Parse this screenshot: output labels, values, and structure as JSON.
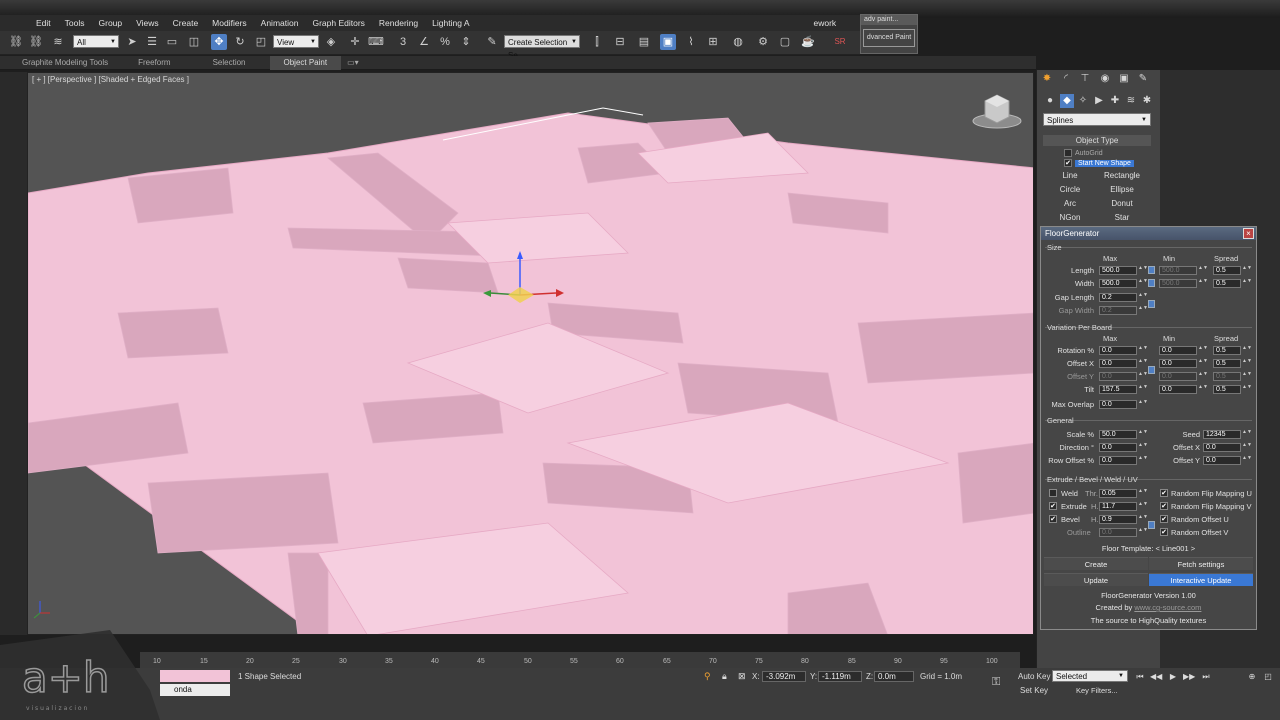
{
  "menu": [
    "Edit",
    "Tools",
    "Group",
    "Views",
    "Create",
    "Modifiers",
    "Animation",
    "Graph Editors",
    "Rendering",
    "Lighting A"
  ],
  "menu_extra": "ework",
  "toolbar": {
    "selection_set": "All",
    "view_dropdown": "View",
    "named_selection": "Create Selection Se"
  },
  "ribbon_tabs": [
    "Graphite Modeling Tools",
    "Freeform",
    "Selection",
    "Object Paint"
  ],
  "ribbon_active": "Object Paint",
  "advpaint": {
    "title": "adv paint...",
    "button": "dvanced Paint"
  },
  "viewport": {
    "label": "[ + ] [Perspective ] [Shaded + Edged Faces ]"
  },
  "command_panel": {
    "category": "Splines",
    "rollout": "Object Type",
    "autogrid": "AutoGrid",
    "start_new_shape": "Start New Shape",
    "shapes": [
      "Line",
      "Rectangle",
      "Circle",
      "Ellipse",
      "Arc",
      "Donut",
      "NGon",
      "Star"
    ]
  },
  "floorgen": {
    "title": "FloorGenerator",
    "size_group": "Size",
    "col_max": "Max",
    "col_min": "Min",
    "col_spread": "Spread",
    "length_label": "Length",
    "length_max": "500.0",
    "length_min": "500.0",
    "length_spread": "0.5",
    "width_label": "Width",
    "width_max": "500.0",
    "width_min": "500.0",
    "width_spread": "0.5",
    "gap_length_label": "Gap Length",
    "gap_length": "0.2",
    "gap_width_label": "Gap Width",
    "gap_width": "0.2",
    "variation_group": "Variation Per Board",
    "rotation_label": "Rotation %",
    "rotation_max": "0.0",
    "rotation_min": "0.0",
    "rotation_spread": "0.5",
    "offsetx_label": "Offset X",
    "offsetx_max": "0.0",
    "offsetx_min": "0.0",
    "offsetx_spread": "0.5",
    "offsety_label": "Offset Y",
    "offsety_max": "0.0",
    "offsety_min": "0.0",
    "offsety_spread": "0.5",
    "tilt_label": "Tilt",
    "tilt_max": "157.5",
    "tilt_min": "0.0",
    "tilt_spread": "0.5",
    "max_overlap_label": "Max Overlap",
    "max_overlap": "0.0",
    "general_group": "General",
    "scale_label": "Scale %",
    "scale": "50.0",
    "seed_label": "Seed",
    "seed": "12345",
    "direction_label": "Direction °",
    "direction": "0.0",
    "goffsetx_label": "Offset X",
    "goffsetx": "0.0",
    "row_offset_label": "Row Offset %",
    "row_offset": "0.0",
    "goffsety_label": "Offset Y",
    "goffsety": "0.0",
    "extrude_group": "Extrude / Bevel / Weld / UV",
    "weld_label": "Weld",
    "weld_thr_label": "Thr.",
    "weld_thr": "0.05",
    "extrude_label": "Extrude",
    "extrude_h_label": "H.",
    "extrude_h": "11.7",
    "bevel_label": "Bevel",
    "bevel_h_label": "H.",
    "bevel_h": "0.9",
    "outline_label": "Outline",
    "outline": "0.0",
    "flip_u": "Random Flip Mapping U",
    "flip_v": "Random Flip Mapping V",
    "offset_u": "Random Offset U",
    "offset_v": "Random Offset V",
    "template": "Floor Template: < Line001 >",
    "create_btn": "Create",
    "fetch_btn": "Fetch settings",
    "update_btn": "Update",
    "interactive_btn": "Interactive Update",
    "version": "FloorGenerator Version 1.00",
    "created_by": "Created by",
    "created_by_link": "www.cg-source.com",
    "tagline": "The source to HighQuality textures"
  },
  "timeline_ticks": [
    "10",
    "15",
    "20",
    "25",
    "30",
    "35",
    "40",
    "45",
    "50",
    "55",
    "60",
    "65",
    "70",
    "75",
    "80",
    "85",
    "90",
    "95",
    "100"
  ],
  "status": {
    "selection": "1 Shape Selected",
    "x_label": "X:",
    "x": "-3.092m",
    "y_label": "Y:",
    "y": "-1.119m",
    "z_label": "Z:",
    "z": "0.0m",
    "grid": "Grid = 1.0m",
    "auto_key": "Auto Key",
    "set_key": "Set Key",
    "key_mode": "Selected",
    "key_filters": "Key Filters...",
    "name_field": "onda"
  },
  "logo": {
    "mark": "a+h",
    "sub": "v i s u a l i z a c i o n"
  },
  "colors": {
    "accent": "#3a78d4",
    "board": "#f4c8db",
    "viewport": "#545454"
  }
}
